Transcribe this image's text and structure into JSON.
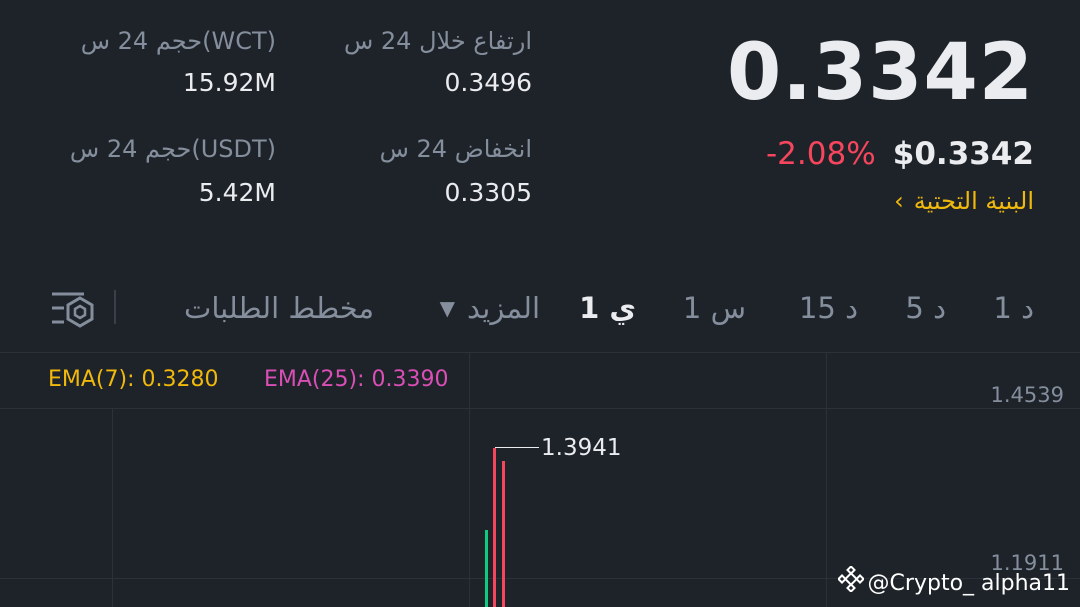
{
  "ticker": {
    "last_price": "0.3342",
    "usd_price": "$0.3342",
    "change_pct": "-2.08%",
    "category": "البنية التحتية"
  },
  "stats": {
    "high_label": "ارتفاع خلال 24 س",
    "high_value": "0.3496",
    "low_label": "انخفاض 24 س",
    "low_value": "0.3305",
    "vol_base_label": "حجم 24 س(WCT)",
    "vol_base_value": "15.92M",
    "vol_quote_label": "حجم 24 س(USDT)",
    "vol_quote_value": "5.42M"
  },
  "tabs": {
    "t1m": "1 د",
    "t5m": "5 د",
    "t15m": "15 د",
    "t1h": "1 س",
    "t1d": "1 ي",
    "more": "المزيد",
    "orderbook": "مخطط الطلبات",
    "active": "1 ي"
  },
  "indicators": {
    "ema7": "EMA(7): 0.3280",
    "ema25": "EMA(25): 0.3390"
  },
  "axis": {
    "top": "1.4539",
    "mid": "1.1911"
  },
  "chart": {
    "high_marker": "1.3941"
  },
  "watermark": "@Crypto_ alpha11",
  "colors": {
    "up": "#0ecb81",
    "down": "#f6465d",
    "accent": "#f0b90b",
    "ema25": "#d94fb5"
  }
}
